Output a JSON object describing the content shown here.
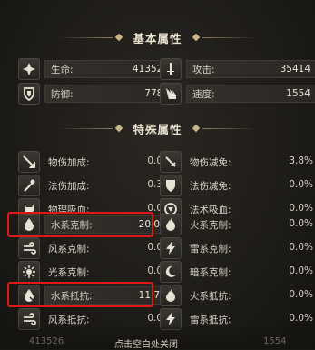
{
  "basic": {
    "title": "基本属性",
    "hp": {
      "label": "生命:",
      "value": "413526",
      "icon": "cross-icon"
    },
    "atk": {
      "label": "攻击:",
      "value": "35414",
      "icon": "sword-icon"
    },
    "def": {
      "label": "防御:",
      "value": "7780",
      "icon": "shield-icon"
    },
    "spd": {
      "label": "速度:",
      "value": "1554",
      "icon": "wing-boot-icon"
    }
  },
  "special": {
    "title": "特殊属性",
    "rows": [
      {
        "left": {
          "label": "物伤加成:",
          "value": "0.0%"
        },
        "right": {
          "label": "物伤减免:",
          "value": "3.8%"
        }
      },
      {
        "left": {
          "label": "法伤加成:",
          "value": "0.3%"
        },
        "right": {
          "label": "法伤减免:",
          "value": "0.0%"
        }
      },
      {
        "left": {
          "label": "物理吸血:",
          "value": "0.0%"
        },
        "right": {
          "label": "法术吸血:",
          "value": "0.0%"
        }
      },
      {
        "left": {
          "label": "水系克制:",
          "value": "20.0%"
        },
        "right": {
          "label": "火系克制:",
          "value": "0.0%"
        }
      },
      {
        "left": {
          "label": "风系克制:",
          "value": "0.0%"
        },
        "right": {
          "label": "雷系克制:",
          "value": "0.0%"
        }
      },
      {
        "left": {
          "label": "光系克制:",
          "value": "0.0%"
        },
        "right": {
          "label": "暗系克制:",
          "value": "0.0%"
        }
      },
      {
        "left": {
          "label": "水系抵抗:",
          "value": "11.7%"
        },
        "right": {
          "label": "火系抵抗:",
          "value": "0.0%"
        }
      },
      {
        "left": {
          "label": "风系抵抗:",
          "value": "0.0%"
        },
        "right": {
          "label": "雷系抵抗:",
          "value": "0.0%"
        }
      }
    ]
  },
  "footer": {
    "left_value": "413526",
    "right_value": "1554",
    "caption": "点击空白处关闭"
  },
  "colors": {
    "highlight": "#e01818",
    "accent": "#c9b585"
  }
}
